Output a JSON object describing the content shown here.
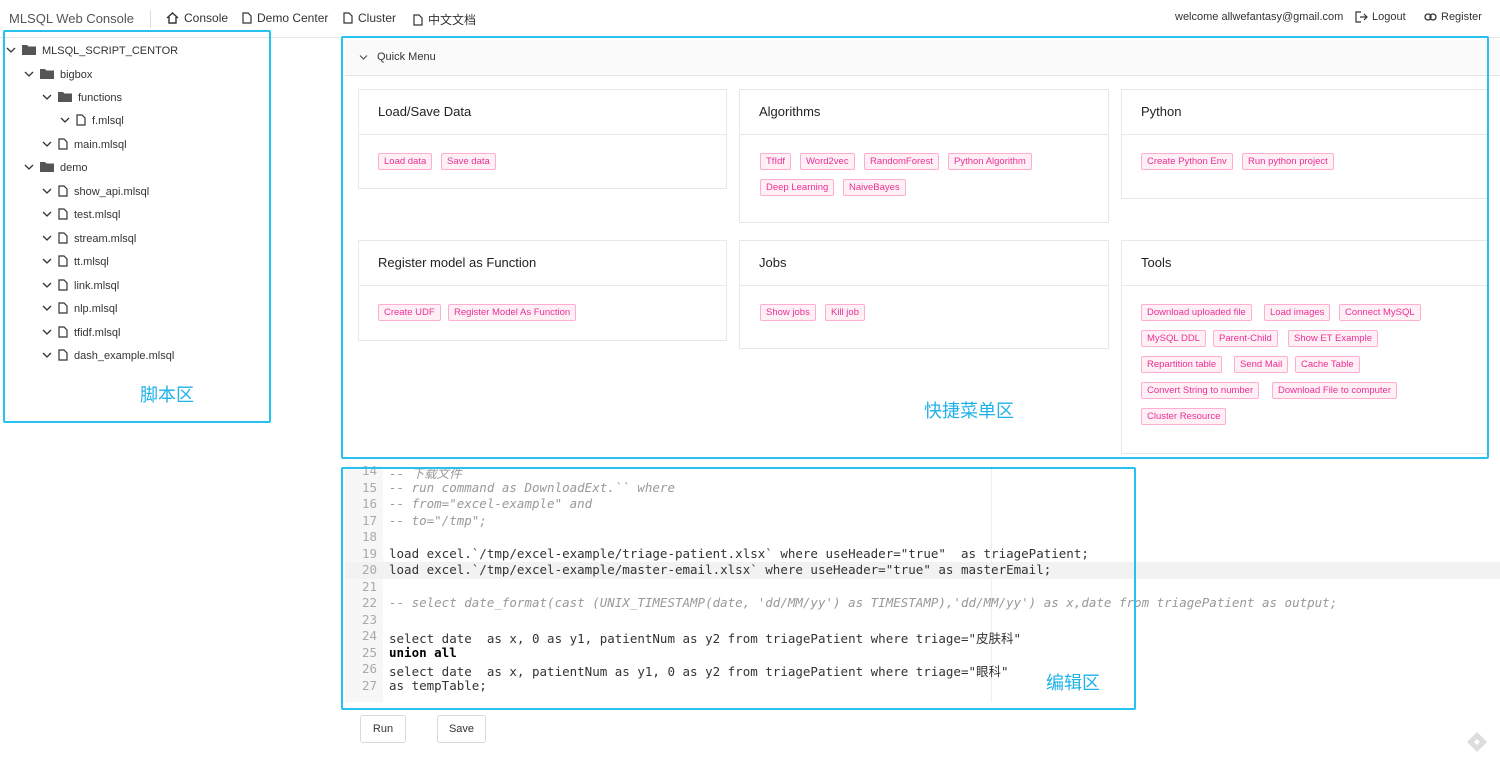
{
  "header": {
    "brand": "MLSQL Web Console",
    "nav": [
      "Console",
      "Demo Center",
      "Cluster",
      "中文文档"
    ],
    "welcome": "welcome allwefantasy@gmail.com",
    "logout": "Logout",
    "register": "Register"
  },
  "tree": {
    "root": "MLSQL_SCRIPT_CENTOR",
    "items": [
      {
        "label": "bigbox",
        "type": "folder"
      },
      {
        "label": "functions",
        "type": "folder"
      },
      {
        "label": "f.mlsql",
        "type": "file"
      },
      {
        "label": "main.mlsql",
        "type": "file"
      },
      {
        "label": "demo",
        "type": "folder"
      },
      {
        "label": "show_api.mlsql",
        "type": "file"
      },
      {
        "label": "test.mlsql",
        "type": "file"
      },
      {
        "label": "stream.mlsql",
        "type": "file"
      },
      {
        "label": "tt.mlsql",
        "type": "file"
      },
      {
        "label": "link.mlsql",
        "type": "file"
      },
      {
        "label": "nlp.mlsql",
        "type": "file"
      },
      {
        "label": "tfidf.mlsql",
        "type": "file"
      },
      {
        "label": "dash_example.mlsql",
        "type": "file"
      }
    ]
  },
  "zones": {
    "script": "脚本区",
    "menu": "快捷菜单区",
    "editor": "编辑区"
  },
  "quick_menu": {
    "title": "Quick Menu",
    "cards": [
      {
        "title": "Load/Save Data",
        "tags": [
          "Load data",
          "Save data"
        ]
      },
      {
        "title": "Algorithms",
        "tags": [
          "TfIdf",
          "Word2vec",
          "RandomForest",
          "Python Algorithm",
          "Deep Learning",
          "NaiveBayes"
        ]
      },
      {
        "title": "Python",
        "tags": [
          "Create Python Env",
          "Run python project"
        ]
      },
      {
        "title": "Register model as Function",
        "tags": [
          "Create UDF",
          "Register Model As Function"
        ]
      },
      {
        "title": "Jobs",
        "tags": [
          "Show jobs",
          "Kill job"
        ]
      },
      {
        "title": "Tools",
        "tags": [
          "Download uploaded file",
          "Load images",
          "Connect MySQL",
          "MySQL DDL",
          "Parent-Child",
          "Show ET Example",
          "Repartition table",
          "Send Mail",
          "Cache Table",
          "Convert String to number",
          "Download File to computer",
          "Cluster Resource"
        ]
      }
    ]
  },
  "editor": {
    "lines": [
      {
        "n": "14",
        "text": "-- 下载文件"
      },
      {
        "n": "15",
        "text": "-- run command as DownloadExt.`` where"
      },
      {
        "n": "16",
        "text": "-- from=\"excel-example\" and"
      },
      {
        "n": "17",
        "text": "-- to=\"/tmp\";"
      },
      {
        "n": "18",
        "text": ""
      },
      {
        "n": "19",
        "text": "load excel.`/tmp/excel-example/triage-patient.xlsx` where useHeader=\"true\"  as triagePatient;"
      },
      {
        "n": "20",
        "text": "load excel.`/tmp/excel-example/master-email.xlsx` where useHeader=\"true\" as masterEmail;"
      },
      {
        "n": "21",
        "text": ""
      },
      {
        "n": "22",
        "text": "-- select date_format(cast (UNIX_TIMESTAMP(date, 'dd/MM/yy') as TIMESTAMP),'dd/MM/yy') as x,date from triagePatient as output;"
      },
      {
        "n": "23",
        "text": ""
      },
      {
        "n": "24",
        "text": "select date  as x, 0 as y1, patientNum as y2 from triagePatient where triage=\"皮肤科\""
      },
      {
        "n": "25",
        "text": "union all"
      },
      {
        "n": "26",
        "text": "select date  as x, patientNum as y1, 0 as y2 from triagePatient where triage=\"眼科\""
      },
      {
        "n": "27",
        "text": "as tempTable;"
      }
    ]
  },
  "actions": {
    "run": "Run",
    "save": "Save"
  }
}
